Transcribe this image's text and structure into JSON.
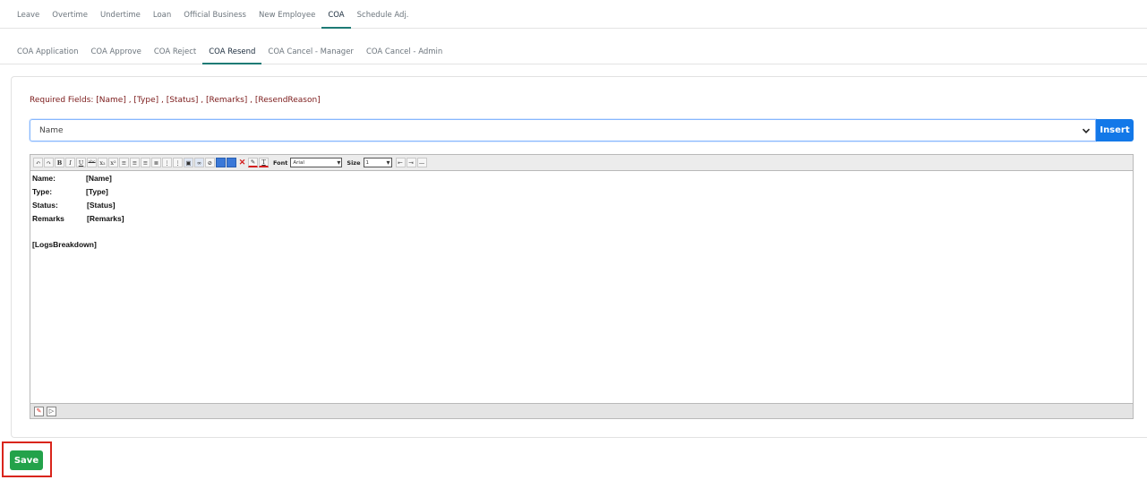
{
  "top_tabs": [
    "Leave",
    "Overtime",
    "Undertime",
    "Loan",
    "Official Business",
    "New Employee",
    "COA",
    "Schedule Adj."
  ],
  "top_active": "COA",
  "sub_tabs": [
    "COA Application",
    "COA Approve",
    "COA Reject",
    "COA Resend",
    "COA Cancel - Manager",
    "COA Cancel - Admin"
  ],
  "sub_active": "COA Resend",
  "required_fields": "Required Fields: [Name] , [Type] , [Status] , [Remarks] , [ResendReason]",
  "field_select": {
    "selected": "Name"
  },
  "insert_label": "Insert",
  "toolbar": {
    "font_label": "Font",
    "font_value": "Arial",
    "size_label": "Size",
    "size_value": "1",
    "buttons": {
      "bold": "B",
      "italic": "I",
      "underline": "U",
      "strike": "abc",
      "subscript": "x₂",
      "superscript": "x²",
      "remove_format": "✕",
      "text_color": "T"
    }
  },
  "editor": {
    "rows": [
      {
        "key": "Name:",
        "value": "[Name]"
      },
      {
        "key": "Type:",
        "value": "[Type]"
      },
      {
        "key": "Status:",
        "value": "[Status]"
      },
      {
        "key": "Remarks",
        "value": "[Remarks]"
      }
    ],
    "footer": "[LogsBreakdown]"
  },
  "save_label": "Save",
  "colors": {
    "accent": "#1378e8",
    "save": "#23a24a",
    "highlight": "#d9251c",
    "required": "#7b1a1a"
  }
}
